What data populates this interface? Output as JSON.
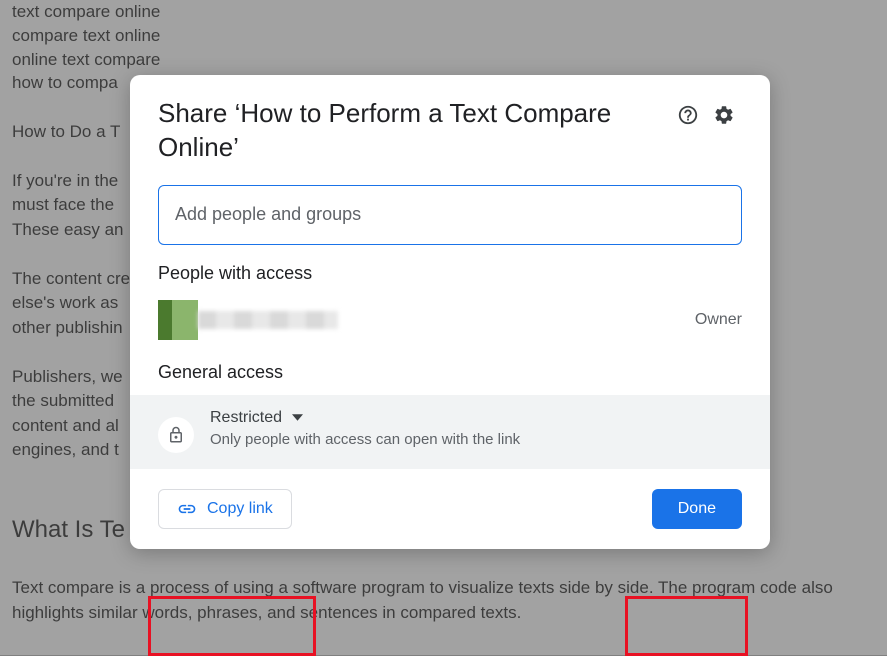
{
  "doc": {
    "lines_tight": [
      "text compare online",
      "compare text online",
      "online text compare",
      "how to compa"
    ],
    "p1": "How to Do a T",
    "p2": "If you're in the\nmust face the\nThese easy an",
    "p3": "The content cre\nelse's work as\nother publishin",
    "p4": "Publishers, we\nthe submitted\ncontent and al\nengines, and t",
    "h2": "What Is Te",
    "p5": "Text compare is a process of using a software program to visualize texts side by side. The program code also highlights similar words, phrases, and sentences in compared texts."
  },
  "dialog": {
    "title": "Share ‘How to Perform a Text Compare Online’",
    "input_placeholder": "Add people and groups",
    "section_people": "People with access",
    "owner_role": "Owner",
    "section_general": "General access",
    "restricted_label": "Restricted",
    "restricted_sub": "Only people with access can open with the link",
    "copy_link": "Copy link",
    "done": "Done"
  }
}
